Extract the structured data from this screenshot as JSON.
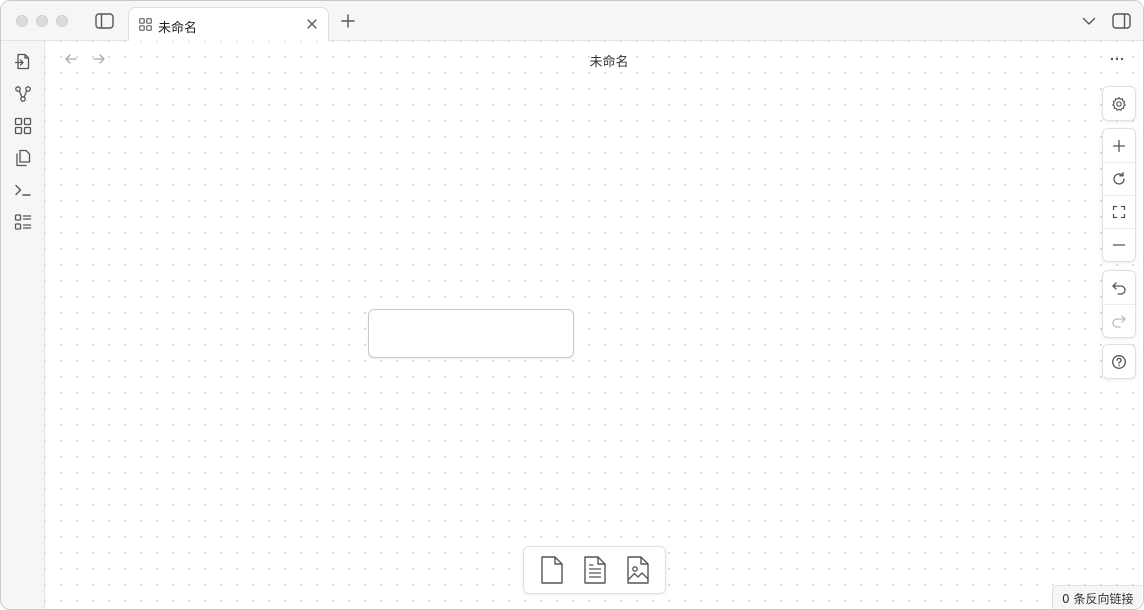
{
  "tab": {
    "title": "未命名"
  },
  "view": {
    "title": "未命名"
  },
  "status": {
    "backlinks": "0 条反向链接"
  },
  "icons": {
    "ribbon": [
      "open-quick-switcher-icon",
      "graph-view-icon",
      "canvas-icon",
      "copy-files-icon",
      "terminal-icon",
      "outline-list-icon"
    ],
    "canvas_controls": [
      "settings-icon",
      "zoom-in-icon",
      "reset-zoom-icon",
      "zoom-to-fit-icon",
      "zoom-out-icon",
      "undo-icon",
      "redo-icon",
      "help-icon"
    ],
    "bottom_bar": [
      "add-card-icon",
      "add-note-icon",
      "add-media-icon"
    ]
  },
  "colors": {
    "chrome": "#f6f6f6",
    "border": "#e3e3e3",
    "icon": "#555555",
    "card_border": "#c8c8c8"
  }
}
